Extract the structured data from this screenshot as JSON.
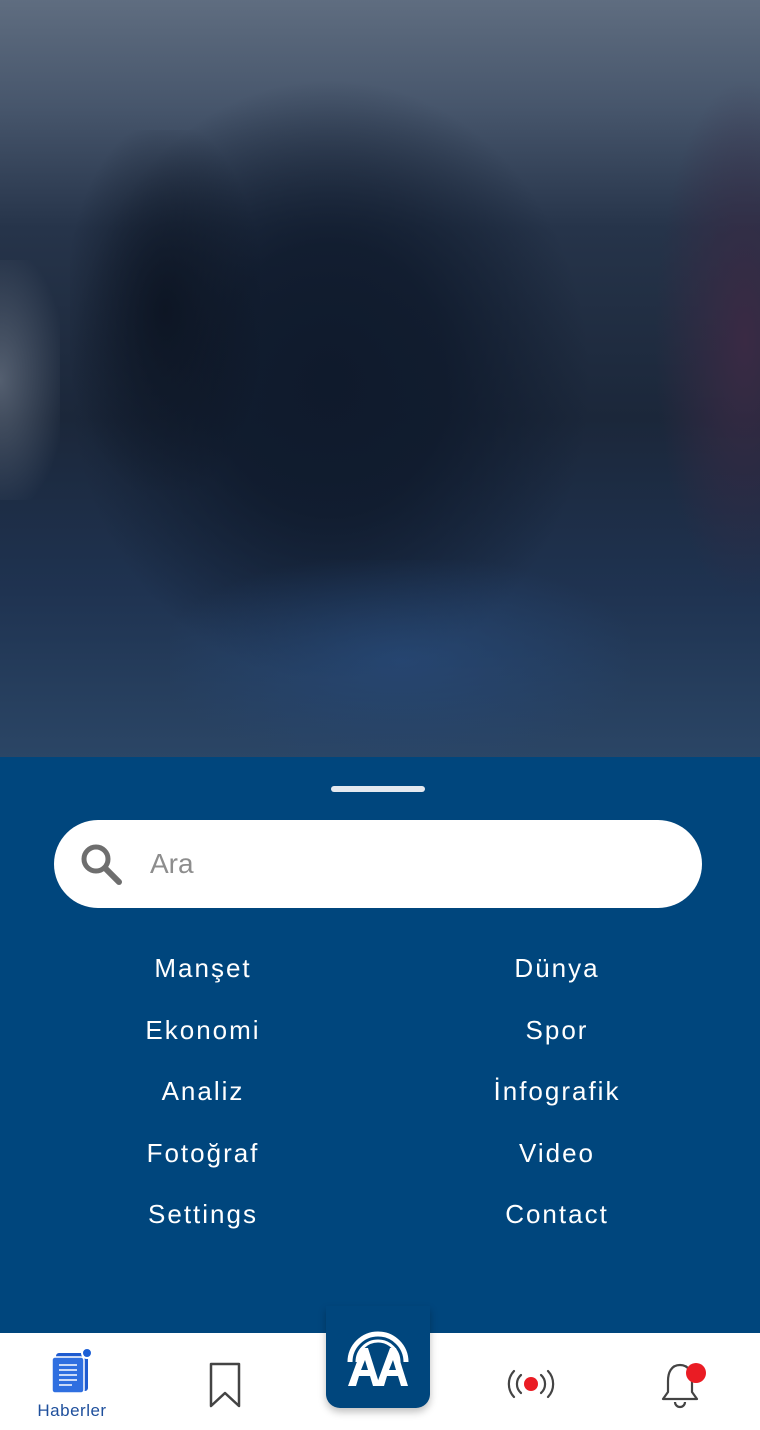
{
  "search": {
    "placeholder": "Ara"
  },
  "menu": {
    "items": [
      "Manşet",
      "Dünya",
      "Ekonomi",
      "Spor",
      "Analiz",
      "İnfografik",
      "Fotoğraf",
      "Video",
      "Settings",
      "Contact"
    ]
  },
  "tabbar": {
    "news_label": "Haberler",
    "icons": [
      "news-icon",
      "bookmark-icon",
      "aa-logo-icon",
      "live-broadcast-icon",
      "bell-icon"
    ]
  },
  "colors": {
    "sheet_bg": "#00467d",
    "accent_blue": "#1e4f9c",
    "notification_red": "#ea1c24",
    "live_red": "#ea1c24"
  }
}
